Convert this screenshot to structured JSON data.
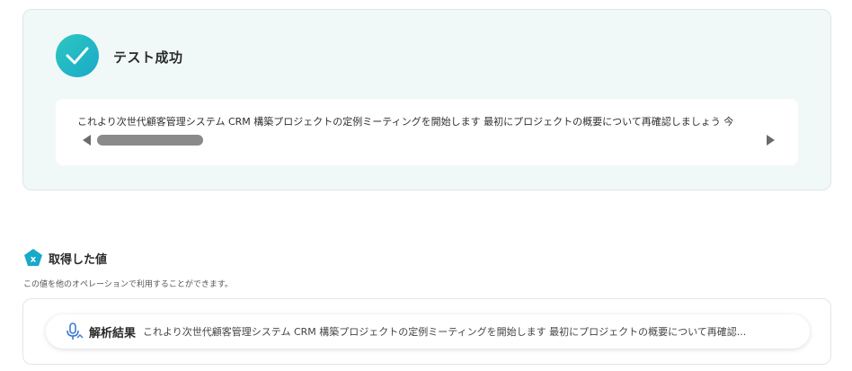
{
  "test_result": {
    "status_title": "テスト成功",
    "output_text": "これより次世代顧客管理システム CRM 構築プロジェクトの定例ミーティングを開始します 最初にプロジェクトの概要について再確認しましょう 今"
  },
  "captured_values": {
    "heading": "取得した値",
    "description": "この値を他のオペレーションで利用することができます。",
    "items": [
      {
        "label": "解析結果",
        "value": "これより次世代顧客管理システム CRM 構築プロジェクトの定例ミーティングを開始します 最初にプロジェクトの概要について再確認..."
      }
    ]
  },
  "colors": {
    "accent": "#18a9c9",
    "success_bg": "#f1f8f8"
  }
}
